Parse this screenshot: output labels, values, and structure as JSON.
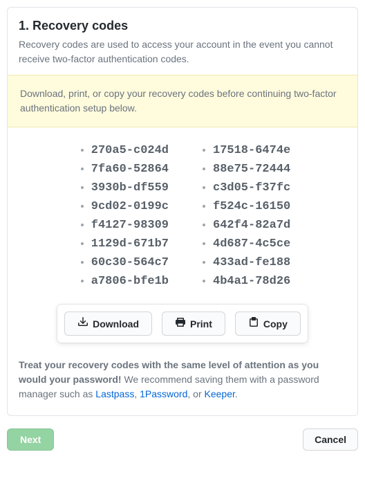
{
  "panel": {
    "title": "1. Recovery codes",
    "description": "Recovery codes are used to access your account in the event you cannot receive two-factor authentication codes.",
    "warning": "Download, print, or copy your recovery codes before continuing two-factor authentication setup below."
  },
  "codes": {
    "col1": [
      "270a5-c024d",
      "7fa60-52864",
      "3930b-df559",
      "9cd02-0199c",
      "f4127-98309",
      "1129d-671b7",
      "60c30-564c7",
      "a7806-bfe1b"
    ],
    "col2": [
      "17518-6474e",
      "88e75-72444",
      "c3d05-f37fc",
      "f524c-16150",
      "642f4-82a7d",
      "4d687-4c5ce",
      "433ad-fe188",
      "4b4a1-78d26"
    ]
  },
  "actions": {
    "download": "Download",
    "print": "Print",
    "copy": "Copy"
  },
  "footnote": {
    "bold": "Treat your recovery codes with the same level of attention as you would your password!",
    "text1": " We recommend saving them with a password manager such as ",
    "link1": "Lastpass",
    "sep1": ", ",
    "link2": "1Password",
    "sep2": ", or ",
    "link3": "Keeper",
    "end": "."
  },
  "bottom": {
    "next": "Next",
    "cancel": "Cancel"
  }
}
